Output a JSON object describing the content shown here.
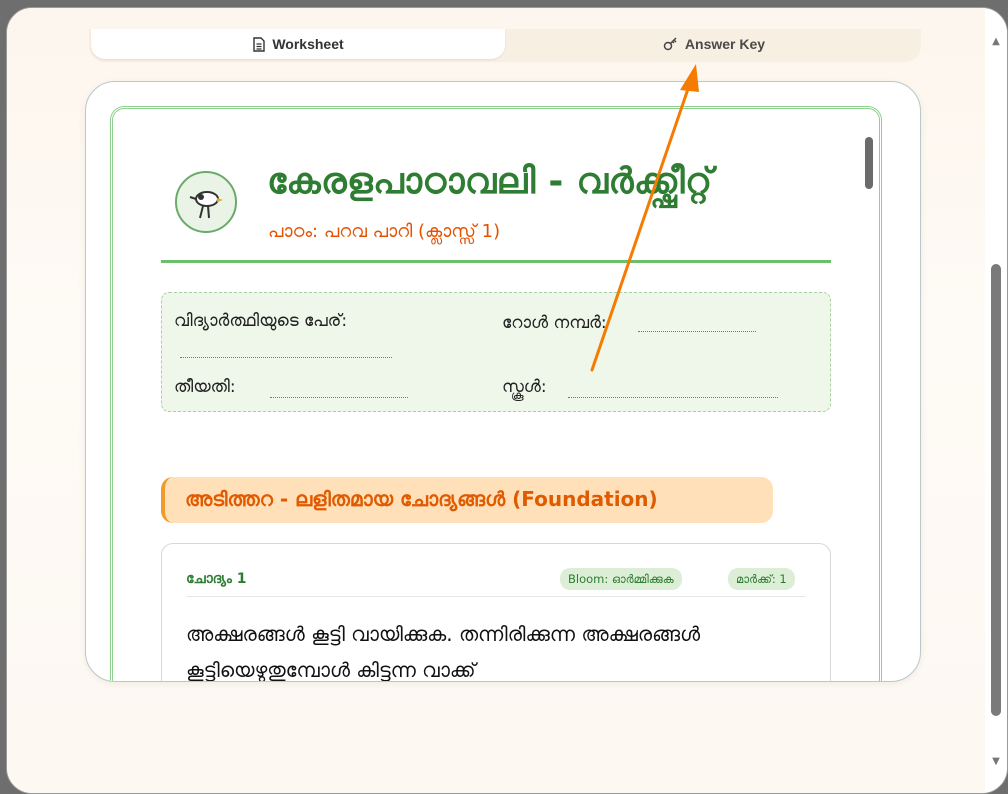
{
  "tabs": [
    {
      "label": "Worksheet",
      "icon": "document-icon",
      "active": true
    },
    {
      "label": "Answer Key",
      "icon": "key-icon",
      "active": false
    }
  ],
  "worksheet": {
    "title": "കേരളപാഠാവലി - വർക്ക്ഷീറ്റ്",
    "subtitle": "പാഠം: പറവ പാറി (ക്ലാസ്സ് 1)",
    "logo_icon": "bird-icon"
  },
  "student_info": {
    "name_label": "വിദ്യാർത്ഥിയുടെ പേര്:",
    "roll_label": "റോൾ നമ്പർ:",
    "date_label": "തീയതി:",
    "school_label": "സ്കൂൾ:"
  },
  "section": {
    "title": "അടിത്തറ - ലളിതമായ ചോദ്യങ്ങൾ (Foundation)"
  },
  "question": {
    "number_label": "ചോദ്യം 1",
    "bloom_badge": "Bloom: ഓർമ്മിക്കുക",
    "marks_badge": "മാർക്ക്: 1",
    "text": "അക്ഷരങ്ങൾ കൂട്ടി വായിക്കുക. തന്നിരിക്കുന്ന അക്ഷരങ്ങൾ കൂട്ടിയെഴുതുമ്പോൾ കിട്ടുന്ന വാക്ക്"
  },
  "colors": {
    "title_green": "#2e7d32",
    "accent_orange": "#e65100",
    "annotation_arrow": "#f57c00"
  }
}
